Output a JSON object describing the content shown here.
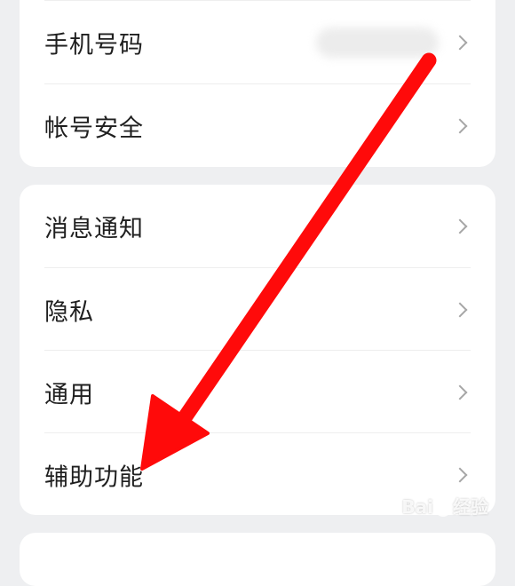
{
  "account_section": {
    "items": [
      {
        "label": "手机号码"
      },
      {
        "label": "帐号安全"
      }
    ]
  },
  "settings_section": {
    "items": [
      {
        "label": "消息通知"
      },
      {
        "label": "隐私"
      },
      {
        "label": "通用"
      },
      {
        "label": "辅助功能"
      }
    ]
  },
  "watermark": {
    "brand_prefix": "Bai",
    "brand_suffix": "经验"
  },
  "colors": {
    "background": "#eeeff1",
    "card": "#ffffff",
    "text": "#1f1f1f",
    "chevron": "#a6a6a6",
    "arrow": "#ff0a0a"
  },
  "icons": {
    "row_chevron": "chevron-right-icon",
    "annotation": "red-arrow-annotation"
  }
}
